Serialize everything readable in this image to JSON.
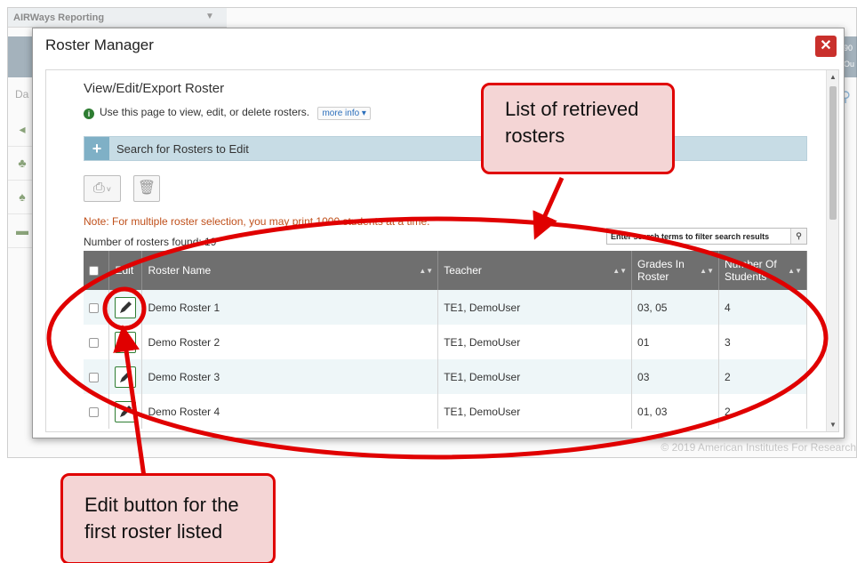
{
  "background_app": {
    "title": "AIRWays Reporting",
    "sidebar_label": "Da",
    "header_right": [
      "90",
      "Ou"
    ],
    "footer": "© 2019 American Institutes For Research"
  },
  "modal": {
    "title": "Roster Manager",
    "close_icon": "close-icon"
  },
  "page": {
    "heading": "View/Edit/Export Roster",
    "info_text": "Use this page to view, edit, or delete rosters.",
    "more_info": "more info",
    "search_section_label": "Search for Rosters to Edit",
    "note": "Note: For multiple roster selection, you may print 1000 students at a time.",
    "count_text": "Number of rosters found: 19",
    "filter_placeholder": "Enter search terms to filter search results"
  },
  "table": {
    "headers": {
      "edit": "Edit",
      "roster_name": "Roster Name",
      "teacher": "Teacher",
      "grades": "Grades In Roster",
      "students": "Number Of Students"
    },
    "rows": [
      {
        "name": "Demo Roster 1",
        "teacher": "TE1, DemoUser",
        "grades": "03, 05",
        "students": "4"
      },
      {
        "name": "Demo Roster 2",
        "teacher": "TE1, DemoUser",
        "grades": "01",
        "students": "3"
      },
      {
        "name": "Demo Roster 3",
        "teacher": "TE1, DemoUser",
        "grades": "03",
        "students": "2"
      },
      {
        "name": "Demo Roster 4",
        "teacher": "TE1, DemoUser",
        "grades": "01, 03",
        "students": "2"
      }
    ]
  },
  "annotations": {
    "list_callout": [
      "List of retrieved",
      "rosters"
    ],
    "edit_callout": [
      "Edit button for the",
      "first roster listed"
    ]
  },
  "colors": {
    "accent_red": "#e00000",
    "header_gray": "#6f6f6f",
    "search_bar": "#c7dce5",
    "edit_green": "#2e7d32"
  }
}
